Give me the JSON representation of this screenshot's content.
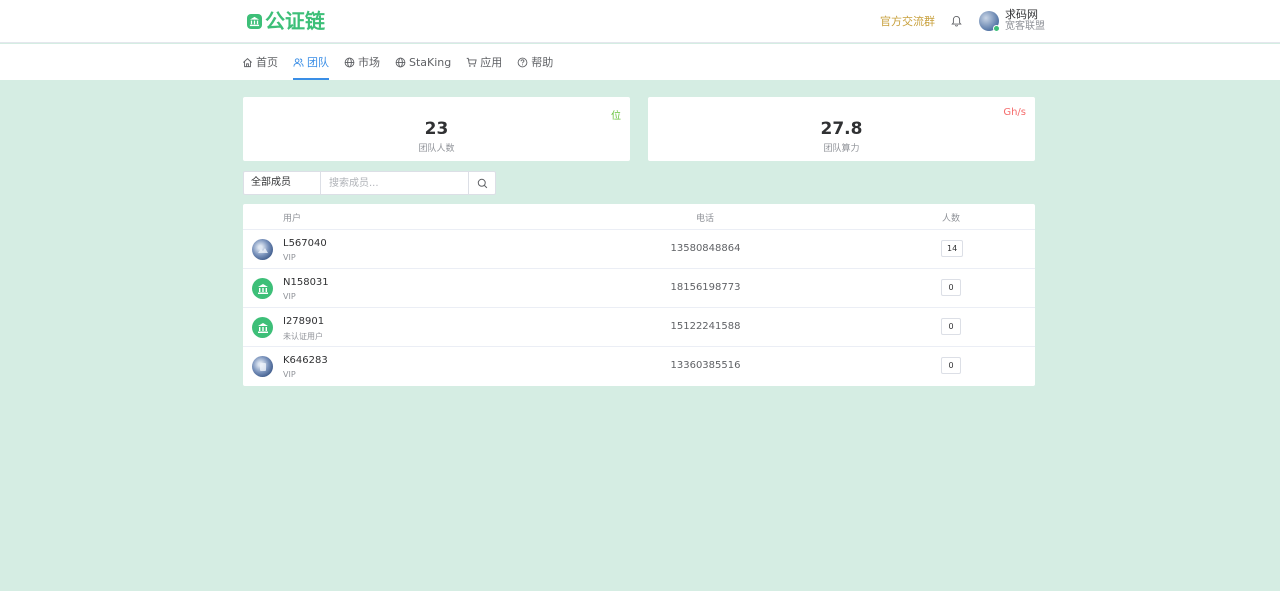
{
  "header": {
    "logo_text": "公证链",
    "group_link": "官方交流群",
    "user_name": "求码网",
    "user_sub": "宽客联盟"
  },
  "nav": {
    "items": [
      {
        "label": "首页",
        "icon": "home-icon"
      },
      {
        "label": "团队",
        "icon": "team-icon",
        "active": true
      },
      {
        "label": "市场",
        "icon": "globe-icon"
      },
      {
        "label": "StaKing",
        "icon": "globe-icon"
      },
      {
        "label": "应用",
        "icon": "cart-icon"
      },
      {
        "label": "帮助",
        "icon": "help-icon"
      }
    ]
  },
  "stats": {
    "members": {
      "value": "23",
      "label": "团队人数",
      "unit": "位",
      "unit_color": "#67c23a"
    },
    "hashrate": {
      "value": "27.8",
      "label": "团队算力",
      "unit": "Gh/s",
      "unit_color": "#f56c6c"
    }
  },
  "filter": {
    "selected": "全部成员",
    "placeholder": "搜索成员..."
  },
  "table": {
    "columns": [
      "用户",
      "电话",
      "人数"
    ],
    "rows": [
      {
        "name": "L567040",
        "level": "VIP",
        "phone": "13580848864",
        "count": "14",
        "avatar": "photo"
      },
      {
        "name": "N158031",
        "level": "VIP",
        "phone": "18156198773",
        "count": "0",
        "avatar": "bank"
      },
      {
        "name": "I278901",
        "level": "未认证用户",
        "phone": "15122241588",
        "count": "0",
        "avatar": "bank"
      },
      {
        "name": "K646283",
        "level": "VIP",
        "phone": "13360385516",
        "count": "0",
        "avatar": "photo"
      }
    ]
  },
  "colors": {
    "brand": "#3dbf78",
    "nav_active": "#3a8ee6",
    "background": "#d5ede3",
    "group_link": "#c8a03c"
  }
}
